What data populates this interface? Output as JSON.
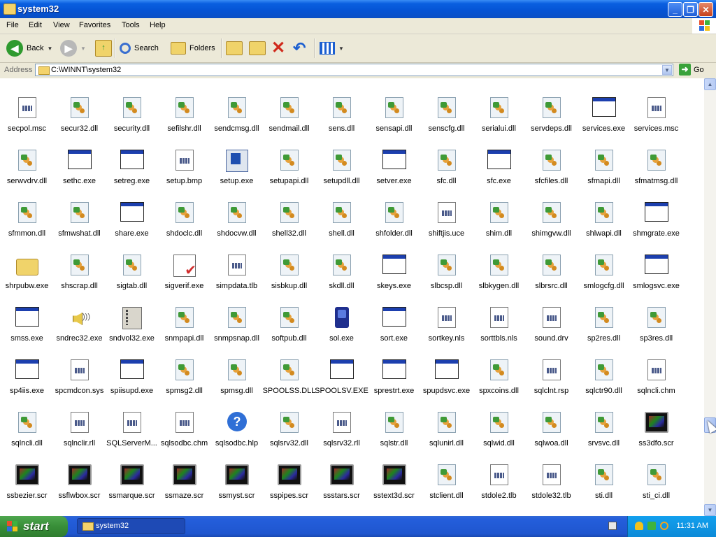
{
  "window": {
    "title": "system32"
  },
  "menubar": {
    "items": [
      "File",
      "Edit",
      "View",
      "Favorites",
      "Tools",
      "Help"
    ]
  },
  "toolbar": {
    "back_label": "Back",
    "search_label": "Search",
    "folders_label": "Folders"
  },
  "address": {
    "label": "Address",
    "path": "C:\\WINNT\\system32",
    "go_label": "Go"
  },
  "files": [
    {
      "name": "secpol.msc",
      "type": "doc"
    },
    {
      "name": "secur32.dll",
      "type": "dll"
    },
    {
      "name": "security.dll",
      "type": "dll"
    },
    {
      "name": "sefilshr.dll",
      "type": "dll"
    },
    {
      "name": "sendcmsg.dll",
      "type": "dll"
    },
    {
      "name": "sendmail.dll",
      "type": "dll"
    },
    {
      "name": "sens.dll",
      "type": "dll"
    },
    {
      "name": "sensapi.dll",
      "type": "dll"
    },
    {
      "name": "senscfg.dll",
      "type": "dll"
    },
    {
      "name": "serialui.dll",
      "type": "dll"
    },
    {
      "name": "servdeps.dll",
      "type": "dll"
    },
    {
      "name": "services.exe",
      "type": "exe"
    },
    {
      "name": "services.msc",
      "type": "doc"
    },
    {
      "name": "serwvdrv.dll",
      "type": "dll"
    },
    {
      "name": "sethc.exe",
      "type": "exe"
    },
    {
      "name": "setreg.exe",
      "type": "exe"
    },
    {
      "name": "setup.bmp",
      "type": "doc"
    },
    {
      "name": "setup.exe",
      "type": "setup"
    },
    {
      "name": "setupapi.dll",
      "type": "dll"
    },
    {
      "name": "setupdll.dll",
      "type": "dll"
    },
    {
      "name": "setver.exe",
      "type": "exe"
    },
    {
      "name": "sfc.dll",
      "type": "dll"
    },
    {
      "name": "sfc.exe",
      "type": "exe"
    },
    {
      "name": "sfcfiles.dll",
      "type": "dll"
    },
    {
      "name": "sfmapi.dll",
      "type": "dll"
    },
    {
      "name": "sfmatmsg.dll",
      "type": "dll"
    },
    {
      "name": "sfmmon.dll",
      "type": "dll"
    },
    {
      "name": "sfmwshat.dll",
      "type": "dll"
    },
    {
      "name": "share.exe",
      "type": "exe"
    },
    {
      "name": "shdoclc.dll",
      "type": "dll"
    },
    {
      "name": "shdocvw.dll",
      "type": "dll"
    },
    {
      "name": "shell32.dll",
      "type": "dll"
    },
    {
      "name": "shell.dll",
      "type": "dll"
    },
    {
      "name": "shfolder.dll",
      "type": "dll"
    },
    {
      "name": "shiftjis.uce",
      "type": "doc"
    },
    {
      "name": "shim.dll",
      "type": "dll"
    },
    {
      "name": "shimgvw.dll",
      "type": "dll"
    },
    {
      "name": "shlwapi.dll",
      "type": "dll"
    },
    {
      "name": "shmgrate.exe",
      "type": "exe"
    },
    {
      "name": "shrpubw.exe",
      "type": "folder"
    },
    {
      "name": "shscrap.dll",
      "type": "dll"
    },
    {
      "name": "sigtab.dll",
      "type": "dll"
    },
    {
      "name": "sigverif.exe",
      "type": "sigv"
    },
    {
      "name": "simpdata.tlb",
      "type": "doc"
    },
    {
      "name": "sisbkup.dll",
      "type": "dll"
    },
    {
      "name": "skdll.dll",
      "type": "dll"
    },
    {
      "name": "skeys.exe",
      "type": "exe"
    },
    {
      "name": "slbcsp.dll",
      "type": "dll"
    },
    {
      "name": "slbkygen.dll",
      "type": "dll"
    },
    {
      "name": "slbrsrc.dll",
      "type": "dll"
    },
    {
      "name": "smlogcfg.dll",
      "type": "dll"
    },
    {
      "name": "smlogsvc.exe",
      "type": "exe"
    },
    {
      "name": "smss.exe",
      "type": "exe"
    },
    {
      "name": "sndrec32.exe",
      "type": "sound"
    },
    {
      "name": "sndvol32.exe",
      "type": "vol"
    },
    {
      "name": "snmpapi.dll",
      "type": "dll"
    },
    {
      "name": "snmpsnap.dll",
      "type": "dll"
    },
    {
      "name": "softpub.dll",
      "type": "dll"
    },
    {
      "name": "sol.exe",
      "type": "sol"
    },
    {
      "name": "sort.exe",
      "type": "exe"
    },
    {
      "name": "sortkey.nls",
      "type": "doc"
    },
    {
      "name": "sorttbls.nls",
      "type": "doc"
    },
    {
      "name": "sound.drv",
      "type": "doc"
    },
    {
      "name": "sp2res.dll",
      "type": "dll"
    },
    {
      "name": "sp3res.dll",
      "type": "dll"
    },
    {
      "name": "sp4iis.exe",
      "type": "exe"
    },
    {
      "name": "spcmdcon.sys",
      "type": "doc"
    },
    {
      "name": "spiisupd.exe",
      "type": "exe"
    },
    {
      "name": "spmsg2.dll",
      "type": "dll"
    },
    {
      "name": "spmsg.dll",
      "type": "dll"
    },
    {
      "name": "SPOOLSS.DLL",
      "type": "dll"
    },
    {
      "name": "SPOOLSV.EXE",
      "type": "exe"
    },
    {
      "name": "sprestrt.exe",
      "type": "exe"
    },
    {
      "name": "spupdsvc.exe",
      "type": "exe"
    },
    {
      "name": "spxcoins.dll",
      "type": "dll"
    },
    {
      "name": "sqlclnt.rsp",
      "type": "doc"
    },
    {
      "name": "sqlctr90.dll",
      "type": "dll"
    },
    {
      "name": "sqlncli.chm",
      "type": "doc"
    },
    {
      "name": "sqlncli.dll",
      "type": "dll"
    },
    {
      "name": "sqlnclir.rll",
      "type": "doc"
    },
    {
      "name": "SQLServerM...",
      "type": "doc"
    },
    {
      "name": "sqlsodbc.chm",
      "type": "doc"
    },
    {
      "name": "sqlsodbc.hlp",
      "type": "hlp"
    },
    {
      "name": "sqlsrv32.dll",
      "type": "dll"
    },
    {
      "name": "sqlsrv32.rll",
      "type": "doc"
    },
    {
      "name": "sqlstr.dll",
      "type": "dll"
    },
    {
      "name": "sqlunirl.dll",
      "type": "dll"
    },
    {
      "name": "sqlwid.dll",
      "type": "dll"
    },
    {
      "name": "sqlwoa.dll",
      "type": "dll"
    },
    {
      "name": "srvsvc.dll",
      "type": "dll"
    },
    {
      "name": "ss3dfo.scr",
      "type": "scr"
    },
    {
      "name": "ssbezier.scr",
      "type": "scr"
    },
    {
      "name": "ssflwbox.scr",
      "type": "scr"
    },
    {
      "name": "ssmarque.scr",
      "type": "scr"
    },
    {
      "name": "ssmaze.scr",
      "type": "scr"
    },
    {
      "name": "ssmyst.scr",
      "type": "scr"
    },
    {
      "name": "sspipes.scr",
      "type": "scr"
    },
    {
      "name": "ssstars.scr",
      "type": "scr"
    },
    {
      "name": "sstext3d.scr",
      "type": "scr"
    },
    {
      "name": "stclient.dll",
      "type": "dll"
    },
    {
      "name": "stdole2.tlb",
      "type": "doc"
    },
    {
      "name": "stdole32.tlb",
      "type": "doc"
    },
    {
      "name": "sti.dll",
      "type": "dll"
    },
    {
      "name": "sti_ci.dll",
      "type": "dll"
    }
  ],
  "taskbar": {
    "start_label": "start",
    "task_label": "system32",
    "clock": "11:31 AM"
  },
  "colors": {
    "titlebar": "#0553d4",
    "taskbar": "#245edb",
    "start": "#388e38",
    "tray": "#0c8ad8"
  }
}
